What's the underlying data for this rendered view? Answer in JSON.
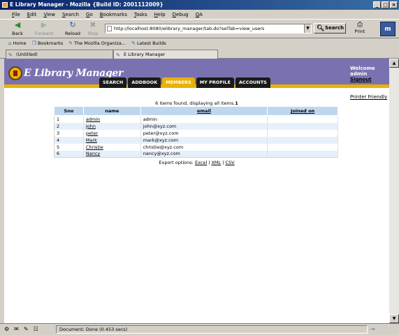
{
  "window": {
    "title": "E Library Manager - Mozilla {Build ID: 2001112009}",
    "buttons": [
      "_",
      "□",
      "×"
    ]
  },
  "menu": [
    "File",
    "Edit",
    "View",
    "Search",
    "Go",
    "Bookmarks",
    "Tasks",
    "Help",
    "Debug",
    "QA"
  ],
  "nav": {
    "back": "Back",
    "forward": "Forward",
    "reload": "Reload",
    "stop": "Stop",
    "url": "http://localhost:8080/elibrary_manager/tab.do?selTab=view_users",
    "search": "Search",
    "print": "Print"
  },
  "bookmarks": [
    "Home",
    "Bookmarks",
    "The Mozilla Organiza...",
    "Latest Builds"
  ],
  "tabs": [
    "(Untitled)",
    "E Library Manager"
  ],
  "app": {
    "title": "E Library Manager",
    "nav_tabs": [
      "Search",
      "AddBook",
      "Members",
      "My Profile",
      "Accounts"
    ],
    "active_tab": "Members",
    "welcome": "Welcome",
    "user": "admin",
    "signout": "Signout",
    "printer_friendly": "Printer Friendly",
    "summary": "6 items found, displaying all items.",
    "summary_page": "1",
    "table": {
      "headers": [
        "Sno",
        "name",
        "email",
        "Joined on"
      ],
      "rows": [
        [
          "1",
          "admin",
          "admin",
          ""
        ],
        [
          "2",
          "John",
          "john@xyz.com",
          ""
        ],
        [
          "3",
          "peter",
          "peter@xyz.com",
          ""
        ],
        [
          "4",
          "Mark",
          "mark@xyz.com",
          ""
        ],
        [
          "5",
          "Christie",
          "christie@xyz.com",
          ""
        ],
        [
          "6",
          "Nancy",
          "nancy@xyz.com",
          ""
        ]
      ]
    },
    "export": {
      "label": "Export options:",
      "options": [
        "Excel",
        "XML",
        "CSV"
      ]
    }
  },
  "status": {
    "text": "Document: Done (0.453 secs)"
  },
  "colors": {
    "header_bg": "#7a72b0",
    "accent": "#e9b200",
    "table_header": "#bfd7ee",
    "row_alt": "#e6f0fa"
  }
}
